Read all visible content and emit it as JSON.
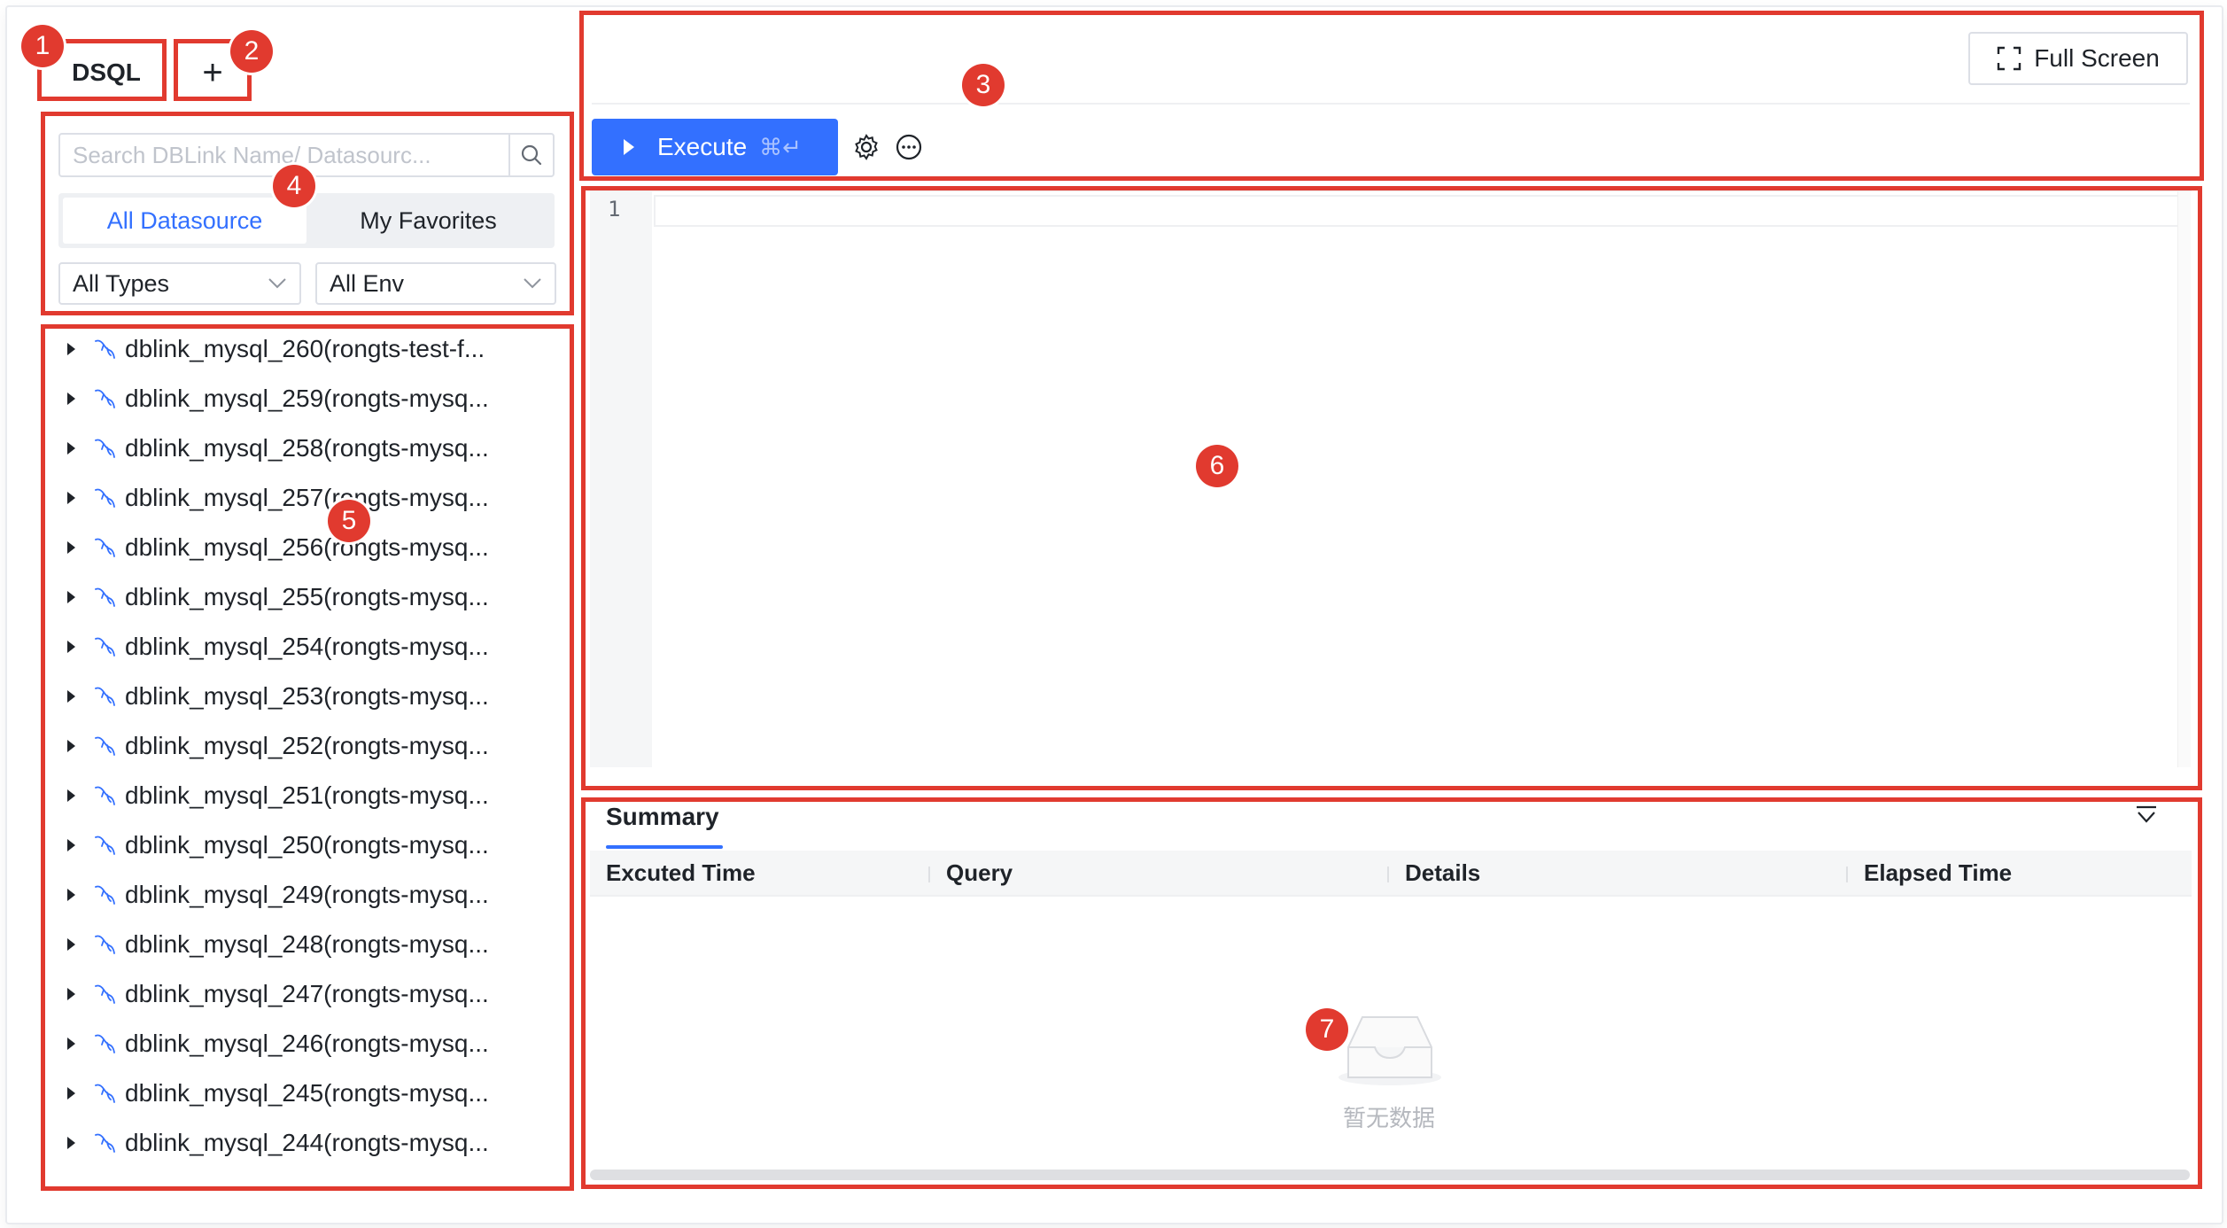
{
  "tabs": {
    "dsql_label": "DSQL",
    "add_label": "+"
  },
  "annotations": [
    "1",
    "2",
    "3",
    "4",
    "5",
    "6",
    "7"
  ],
  "datasource": {
    "search_placeholder": "Search DBLink Name/ Datasourc...",
    "segments": [
      "All Datasource",
      "My Favorites"
    ],
    "active_segment": "All Datasource",
    "type_filter": "All Types",
    "env_filter": "All Env"
  },
  "tree_items": [
    "dblink_mysql_260(rongts-test-f...",
    "dblink_mysql_259(rongts-mysq...",
    "dblink_mysql_258(rongts-mysq...",
    "dblink_mysql_257(rongts-mysq...",
    "dblink_mysql_256(rongts-mysq...",
    "dblink_mysql_255(rongts-mysq...",
    "dblink_mysql_254(rongts-mysq...",
    "dblink_mysql_253(rongts-mysq...",
    "dblink_mysql_252(rongts-mysq...",
    "dblink_mysql_251(rongts-mysq...",
    "dblink_mysql_250(rongts-mysq...",
    "dblink_mysql_249(rongts-mysq...",
    "dblink_mysql_248(rongts-mysq...",
    "dblink_mysql_247(rongts-mysq...",
    "dblink_mysql_246(rongts-mysq...",
    "dblink_mysql_245(rongts-mysq...",
    "dblink_mysql_244(rongts-mysq..."
  ],
  "toolbar": {
    "full_screen_label": "Full Screen",
    "execute_label": "Execute",
    "execute_shortcut": "⌘↵",
    "settings_icon": "gear-icon",
    "more_icon": "more-icon"
  },
  "editor": {
    "line_number": "1"
  },
  "summary": {
    "tab_label": "Summary",
    "columns": [
      "Excuted Time",
      "Query",
      "Details",
      "Elapsed Time"
    ],
    "empty_text": "暂无数据"
  },
  "colors": {
    "accent": "#3370ff",
    "annotation_red": "#e13a2f"
  }
}
